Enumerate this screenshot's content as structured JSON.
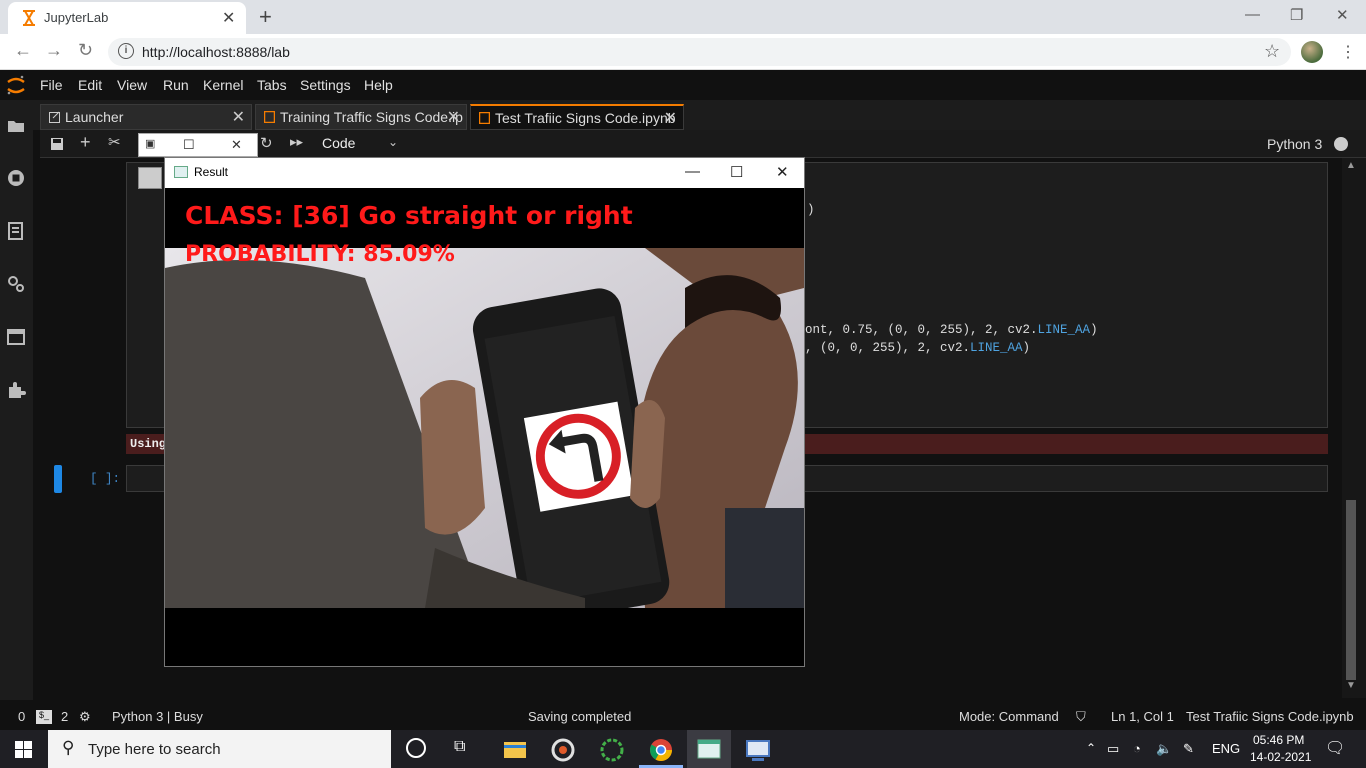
{
  "browser": {
    "tab_title": "JupyterLab",
    "url": "http://localhost:8888/lab"
  },
  "menu": [
    "File",
    "Edit",
    "View",
    "Run",
    "Kernel",
    "Tabs",
    "Settings",
    "Help"
  ],
  "dock_tabs": [
    {
      "label": "Launcher"
    },
    {
      "label": "Training Traffic Signs Code.ip"
    },
    {
      "label": "Test Trafiic Signs Code.ipynb"
    }
  ],
  "toolbar": {
    "cell_type": "Code",
    "kernel_name": "Python 3"
  },
  "code": {
    "line1_text": "ont, 0.75, (0, 0, 255), 2, cv2.",
    "line1_attr": "LINE_AA",
    "line1_close": ")",
    "line2_text": ", (0, 0, 255), 2, cv2.",
    "line2_attr": "LINE_AA",
    "line2_close": ")",
    "top_close": ")",
    "stderr_prefix": "Using",
    "prompt": "[ ]:"
  },
  "result_window": {
    "title": "Result",
    "class_text": "CLASS:  [36] Go straight or right",
    "probability_text": "PROBABILITY: 85.09%"
  },
  "status": {
    "mode_count_a": "0",
    "mode_count_b": "2",
    "kernel": "Python 3 | Busy",
    "saving": "Saving completed",
    "mode": "Mode: Command",
    "cursor": "Ln 1, Col 1",
    "file": "Test Trafiic Signs Code.ipynb"
  },
  "taskbar": {
    "search_placeholder": "Type here to search",
    "language": "ENG",
    "time": "05:46 PM",
    "date": "14-02-2021"
  },
  "colors": {
    "accent": "#f57c00",
    "prediction_text": "#ff1a1a",
    "active_cell": "#1e88e5"
  }
}
